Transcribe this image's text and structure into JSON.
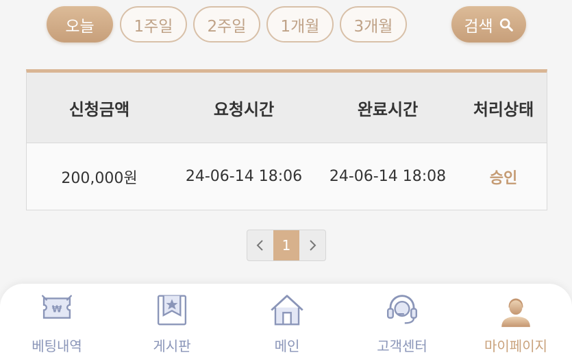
{
  "filters": {
    "periods": [
      "오늘",
      "1주일",
      "2주일",
      "1개월",
      "3개월"
    ],
    "active_index": 0,
    "search_label": "검색"
  },
  "table": {
    "headers": [
      "신청금액",
      "요청시간",
      "완료시간",
      "처리상태"
    ],
    "rows": [
      [
        "200,000원",
        "24-06-14 18:06",
        "24-06-14 18:08",
        "승인"
      ]
    ]
  },
  "pagination": {
    "current_page": "1"
  },
  "bottom_nav": {
    "items": [
      {
        "label": "베팅내역",
        "icon": "betting-ticket-icon"
      },
      {
        "label": "게시판",
        "icon": "bookmark-star-icon"
      },
      {
        "label": "메인",
        "icon": "home-icon"
      },
      {
        "label": "고객센터",
        "icon": "headset-icon"
      },
      {
        "label": "마이페이지",
        "icon": "user-icon"
      }
    ],
    "active_index": 4
  },
  "colors": {
    "accent": "#c9a27c",
    "nav_inactive": "#8a95b8",
    "table_top_border": "#d9b594"
  }
}
